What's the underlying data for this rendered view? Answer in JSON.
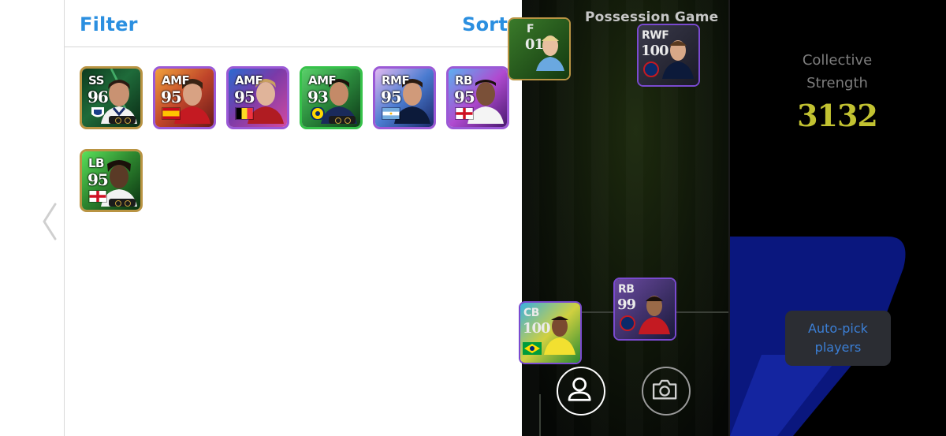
{
  "panel": {
    "filter_label": "Filter",
    "sort_label": "Sort"
  },
  "cards": [
    {
      "position": "SS",
      "rating": "96",
      "flag": "club-crest",
      "frame_color": "#b99443",
      "bg_color": "#1f6b3a"
    },
    {
      "position": "AMF",
      "rating": "95",
      "flag": "spain",
      "frame_color": "#9b59d6",
      "bg_color": "#c0452a"
    },
    {
      "position": "AMF",
      "rating": "95",
      "flag": "belgium",
      "frame_color": "#9b59d6",
      "bg_color": "#7a3aa8"
    },
    {
      "position": "AMF",
      "rating": "93",
      "flag": "fenerbahce-crest",
      "frame_color": "#36c24a",
      "bg_color": "#2d8f3f"
    },
    {
      "position": "RMF",
      "rating": "95",
      "flag": "argentina",
      "frame_color": "#9b59d6",
      "bg_color": "#4a7bd0"
    },
    {
      "position": "RB",
      "rating": "95",
      "flag": "england",
      "frame_color": "#9b59d6",
      "bg_color": "#b04ad0"
    },
    {
      "position": "LB",
      "rating": "95",
      "flag": "england",
      "frame_color": "#b99443",
      "bg_color": "#2f8a30"
    }
  ],
  "game": {
    "mode_title": "Possession Game",
    "collective_strength_label_line1": "Collective",
    "collective_strength_label_line2": "Strength",
    "collective_strength_value": "3132",
    "autopick_line1": "Auto-pick",
    "autopick_line2": "players",
    "field_cards": [
      {
        "position": "RWF",
        "rating": "100"
      },
      {
        "position": "RB",
        "rating": "99"
      },
      {
        "position": "CB",
        "rating": "100"
      }
    ],
    "partial_card_text": "F",
    "partial_card_rating": "01"
  },
  "colors": {
    "accent": "#2b8fe0",
    "strength_value": "#c2c231",
    "autopick_text": "#3b7fd6"
  },
  "icons": [
    "chevron-left-icon",
    "person-icon",
    "camera-icon"
  ]
}
